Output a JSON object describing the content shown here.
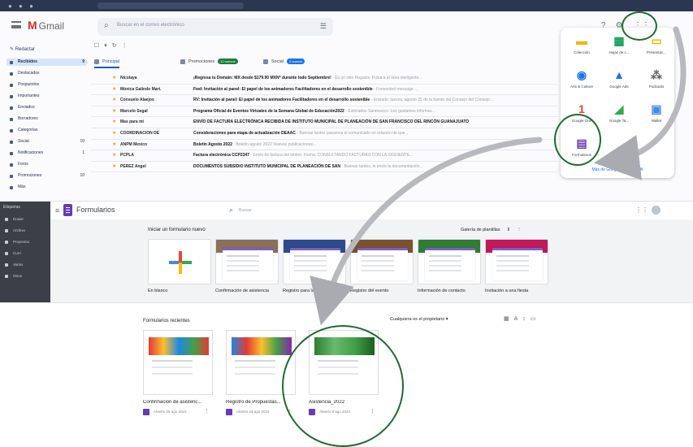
{
  "gmail": {
    "app_name": "Gmail",
    "search_placeholder": "Buscar en el correo electrónico",
    "compose_label": "Redactar",
    "sidebar": [
      {
        "label": "Recibidos",
        "count": "9",
        "active": true
      },
      {
        "label": "Destacados",
        "count": ""
      },
      {
        "label": "Pospuestos",
        "count": ""
      },
      {
        "label": "Importantes",
        "count": ""
      },
      {
        "label": "Enviados",
        "count": ""
      },
      {
        "label": "Borradores",
        "count": ""
      },
      {
        "label": "Categorías",
        "count": ""
      },
      {
        "label": "Social",
        "count": "10"
      },
      {
        "label": "Notificaciones",
        "count": "1"
      },
      {
        "label": "Foros",
        "count": ""
      },
      {
        "label": "Promociones",
        "count": "10"
      },
      {
        "label": "Más",
        "count": ""
      }
    ],
    "tabs": [
      {
        "label": "Principal",
        "badge": "",
        "active": true
      },
      {
        "label": "Promociones",
        "badge": "10 nuevos"
      },
      {
        "label": "Social",
        "badge": "2 nuevos"
      }
    ],
    "rows": [
      {
        "sender": "Nicolaya",
        "subject": "¡Regresa tu Domain: MX desde $179.90 MXN* durante todo Septiembre!",
        "snippet": " - Es un sitio Regalos. Pulsa a el área inteligente..."
      },
      {
        "sender": "Mónica Galindo Mart.",
        "subject": "Fwd: Invitación al panel: El papel de los animadores Facilitadores en el desarrollo sostenible",
        "snippet": " - Forwarded message ..."
      },
      {
        "sender": "Consuelo Alaejos",
        "subject": "RV: Invitación al panel: El papel de los animadores Facilitadores en el desarrollo sostenible",
        "snippet": " - Enviado: jueves, agosto 25 de la fuente del Consejo del Consejo..."
      },
      {
        "sender": "Marcelo Segal",
        "subject": "Programa Oficial de Eventos Virtuales de la Semana Global de Educación2022",
        "snippet": " - Estimados Sanmexico: Los gustamos informar..."
      },
      {
        "sender": "Mas para mi",
        "subject": "ENVÍO DE FACTURA ELECTRÓNICA RECIBIDA DE INSTITUTO MUNICIPAL DE PLANEACIÓN DE SAN FRANCISCO DEL RINCÓN GUANAJUATO",
        "snippet": ""
      },
      {
        "sender": "COORDINACION DE",
        "subject": "Consideraciones para etapa de actualización DEAAC",
        "snippet": " - Buenas tardes pasamos el comunicado en relación de que..."
      },
      {
        "sender": "ANPM Mexico",
        "subject": "Boletín Agosto 2022",
        "snippet": " - Boletín agosto 2022 Nuevas publicaciones..."
      },
      {
        "sender": "PCPLA",
        "subject": "Factura electrónica CCP2347",
        "snippet": " - Envío de factura del timbre. Fecha: CONSULTANDO FACTURAS CON LA SIGUIENTE..."
      },
      {
        "sender": "PEREZ Angel",
        "subject": "DOCUMENTOS SUBSIDIO INSTITUTO MUNICIPAL DE PLANEACIÓN DE SAN",
        "snippet": " - Buenas tardes, le envío la documentación..."
      }
    ],
    "apps": [
      {
        "label": "Colección",
        "glyph": "▬",
        "color": "#f4b400"
      },
      {
        "label": "Hojas de c...",
        "glyph": "▦",
        "color": "#0f9d58"
      },
      {
        "label": "Presentac...",
        "glyph": "▭",
        "color": "#f4b400"
      },
      {
        "label": "Arts & Culture",
        "glyph": "◉",
        "color": "#1a73e8"
      },
      {
        "label": "Google Ads",
        "glyph": "▲",
        "color": "#1a73e8"
      },
      {
        "label": "Podcasts",
        "glyph": "⁂",
        "color": "#5f6368"
      },
      {
        "label": "Google One",
        "glyph": "1",
        "color": "#ea4335"
      },
      {
        "label": "Google Ta...",
        "glyph": "◢",
        "color": "#34a853"
      },
      {
        "label": "Wallet",
        "glyph": "▣",
        "color": "#4285f4"
      },
      {
        "label": "Formularios",
        "glyph": "▤",
        "color": "#673ab7"
      }
    ],
    "apps_more": "Más de Google para tu perfil"
  },
  "forms": {
    "rail_label": "Etiquetas",
    "rail_items": [
      "Dosier",
      "Archivo",
      "Proyectos",
      "Curri",
      "Varios",
      "Otros"
    ],
    "title": "Formularios",
    "search_placeholder": "Buscar",
    "start_title": "Iniciar un formulario nuevo",
    "gallery_label": "Galería de plantillas",
    "templates": [
      {
        "name": "En blanco"
      },
      {
        "name": "Confirmación de asistencia"
      },
      {
        "name": "Registro para la clase"
      },
      {
        "name": "Registro del evento"
      },
      {
        "name": "Información de contacto"
      },
      {
        "name": "Invitación a una fiesta"
      }
    ]
  },
  "recent": {
    "title": "Formularios recientes",
    "owner_filter": "Cualquiera es el propietario",
    "docs": [
      {
        "name": "Confirmación de asistenc...",
        "meta": "Abierto 25 ago 2022"
      },
      {
        "name": "Registro de Propuestas...",
        "meta": "Abierto 24 ago 2022"
      },
      {
        "name": "Asistencia_2022",
        "meta": "Abierto 9 ago 2022"
      }
    ]
  }
}
